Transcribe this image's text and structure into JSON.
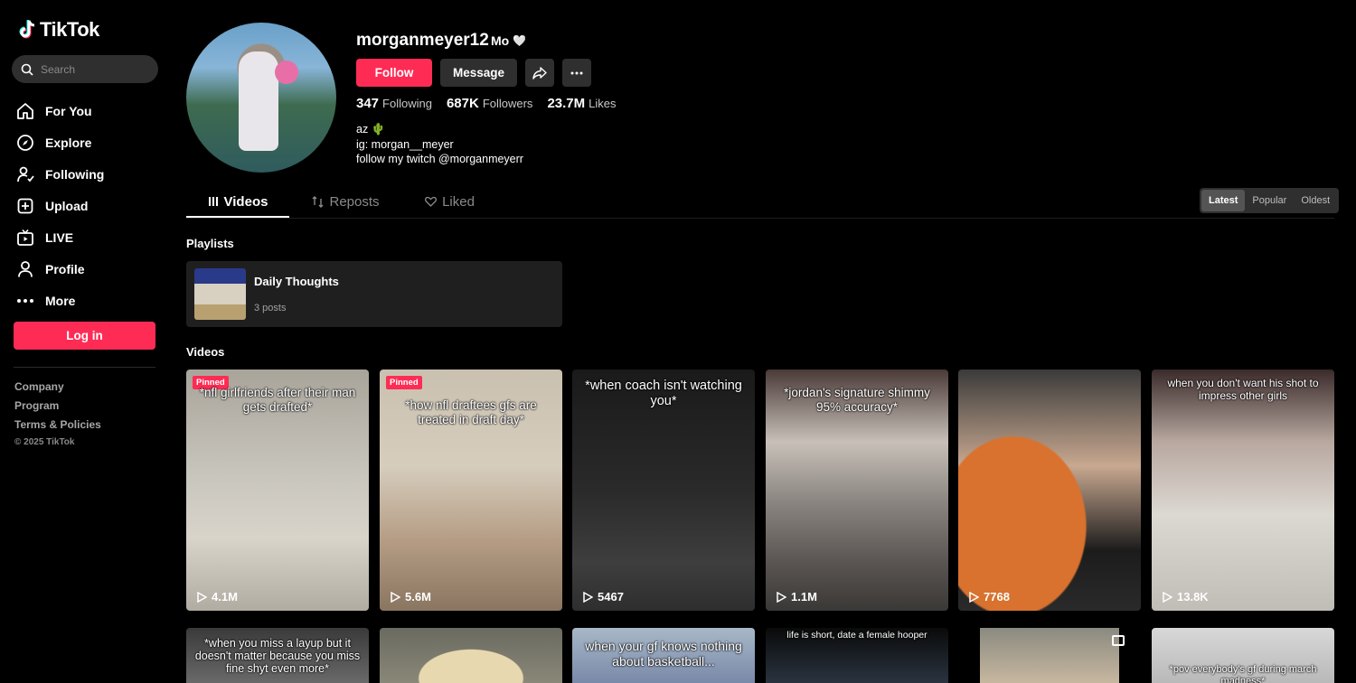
{
  "sidebar": {
    "logo_text": "TikTok",
    "search_placeholder": "Search",
    "nav": [
      {
        "label": "For You",
        "icon": "home-icon"
      },
      {
        "label": "Explore",
        "icon": "compass-icon"
      },
      {
        "label": "Following",
        "icon": "following-icon"
      },
      {
        "label": "Upload",
        "icon": "upload-icon"
      },
      {
        "label": "LIVE",
        "icon": "live-icon"
      },
      {
        "label": "Profile",
        "icon": "profile-icon"
      },
      {
        "label": "More",
        "icon": "more-icon"
      }
    ],
    "login_label": "Log in",
    "footer": {
      "company": "Company",
      "program": "Program",
      "terms": "Terms & Policies",
      "copyright": "© 2025 TikTok"
    }
  },
  "profile": {
    "username": "morganmeyer12",
    "nickname": "Mo",
    "nickname_emoji": "🤍",
    "follow_label": "Follow",
    "message_label": "Message",
    "stats": {
      "following": "347",
      "following_label": "Following",
      "followers": "687K",
      "followers_label": "Followers",
      "likes": "23.7M",
      "likes_label": "Likes"
    },
    "bio": [
      "az 🌵",
      "ig: morgan__meyer",
      "follow my twitch @morganmeyerr"
    ]
  },
  "tabs": {
    "videos": "Videos",
    "reposts": "Reposts",
    "liked": "Liked"
  },
  "sort": {
    "latest": "Latest",
    "popular": "Popular",
    "oldest": "Oldest",
    "selected": "Latest"
  },
  "playlists": {
    "section_title": "Playlists",
    "items": [
      {
        "title": "Daily Thoughts",
        "count": "3 posts"
      }
    ]
  },
  "videos": {
    "section_title": "Videos",
    "pinned_label": "Pinned",
    "row1": [
      {
        "caption": "*nfl girlfriends after their man gets drafted*",
        "views": "4.1M",
        "pinned": true
      },
      {
        "caption": "*how nfl draftees gfs are treated in draft day*",
        "views": "5.6M",
        "pinned": true
      },
      {
        "caption": "*when coach isn't watching you*",
        "views": "5467",
        "pinned": false
      },
      {
        "caption": "*jordan's signature shimmy 95% accuracy*",
        "views": "1.1M",
        "pinned": false
      },
      {
        "caption": "",
        "views": "7768",
        "pinned": false
      },
      {
        "caption": "when you don't want his shot to impress other girls",
        "views": "13.8K",
        "pinned": false
      }
    ],
    "row2": [
      {
        "caption": "*when you miss a layup but it doesn't matter because you miss fine shyt even more*"
      },
      {
        "caption": ""
      },
      {
        "caption": "when your gf knows nothing about basketball..."
      },
      {
        "caption": "life is short, date a female hooper"
      },
      {
        "caption": ""
      },
      {
        "caption": "*pov everybody's gf during march madness*"
      }
    ]
  },
  "colors": {
    "accent": "#fe2c55",
    "background": "#000000",
    "surface": "#2f2f2f"
  }
}
